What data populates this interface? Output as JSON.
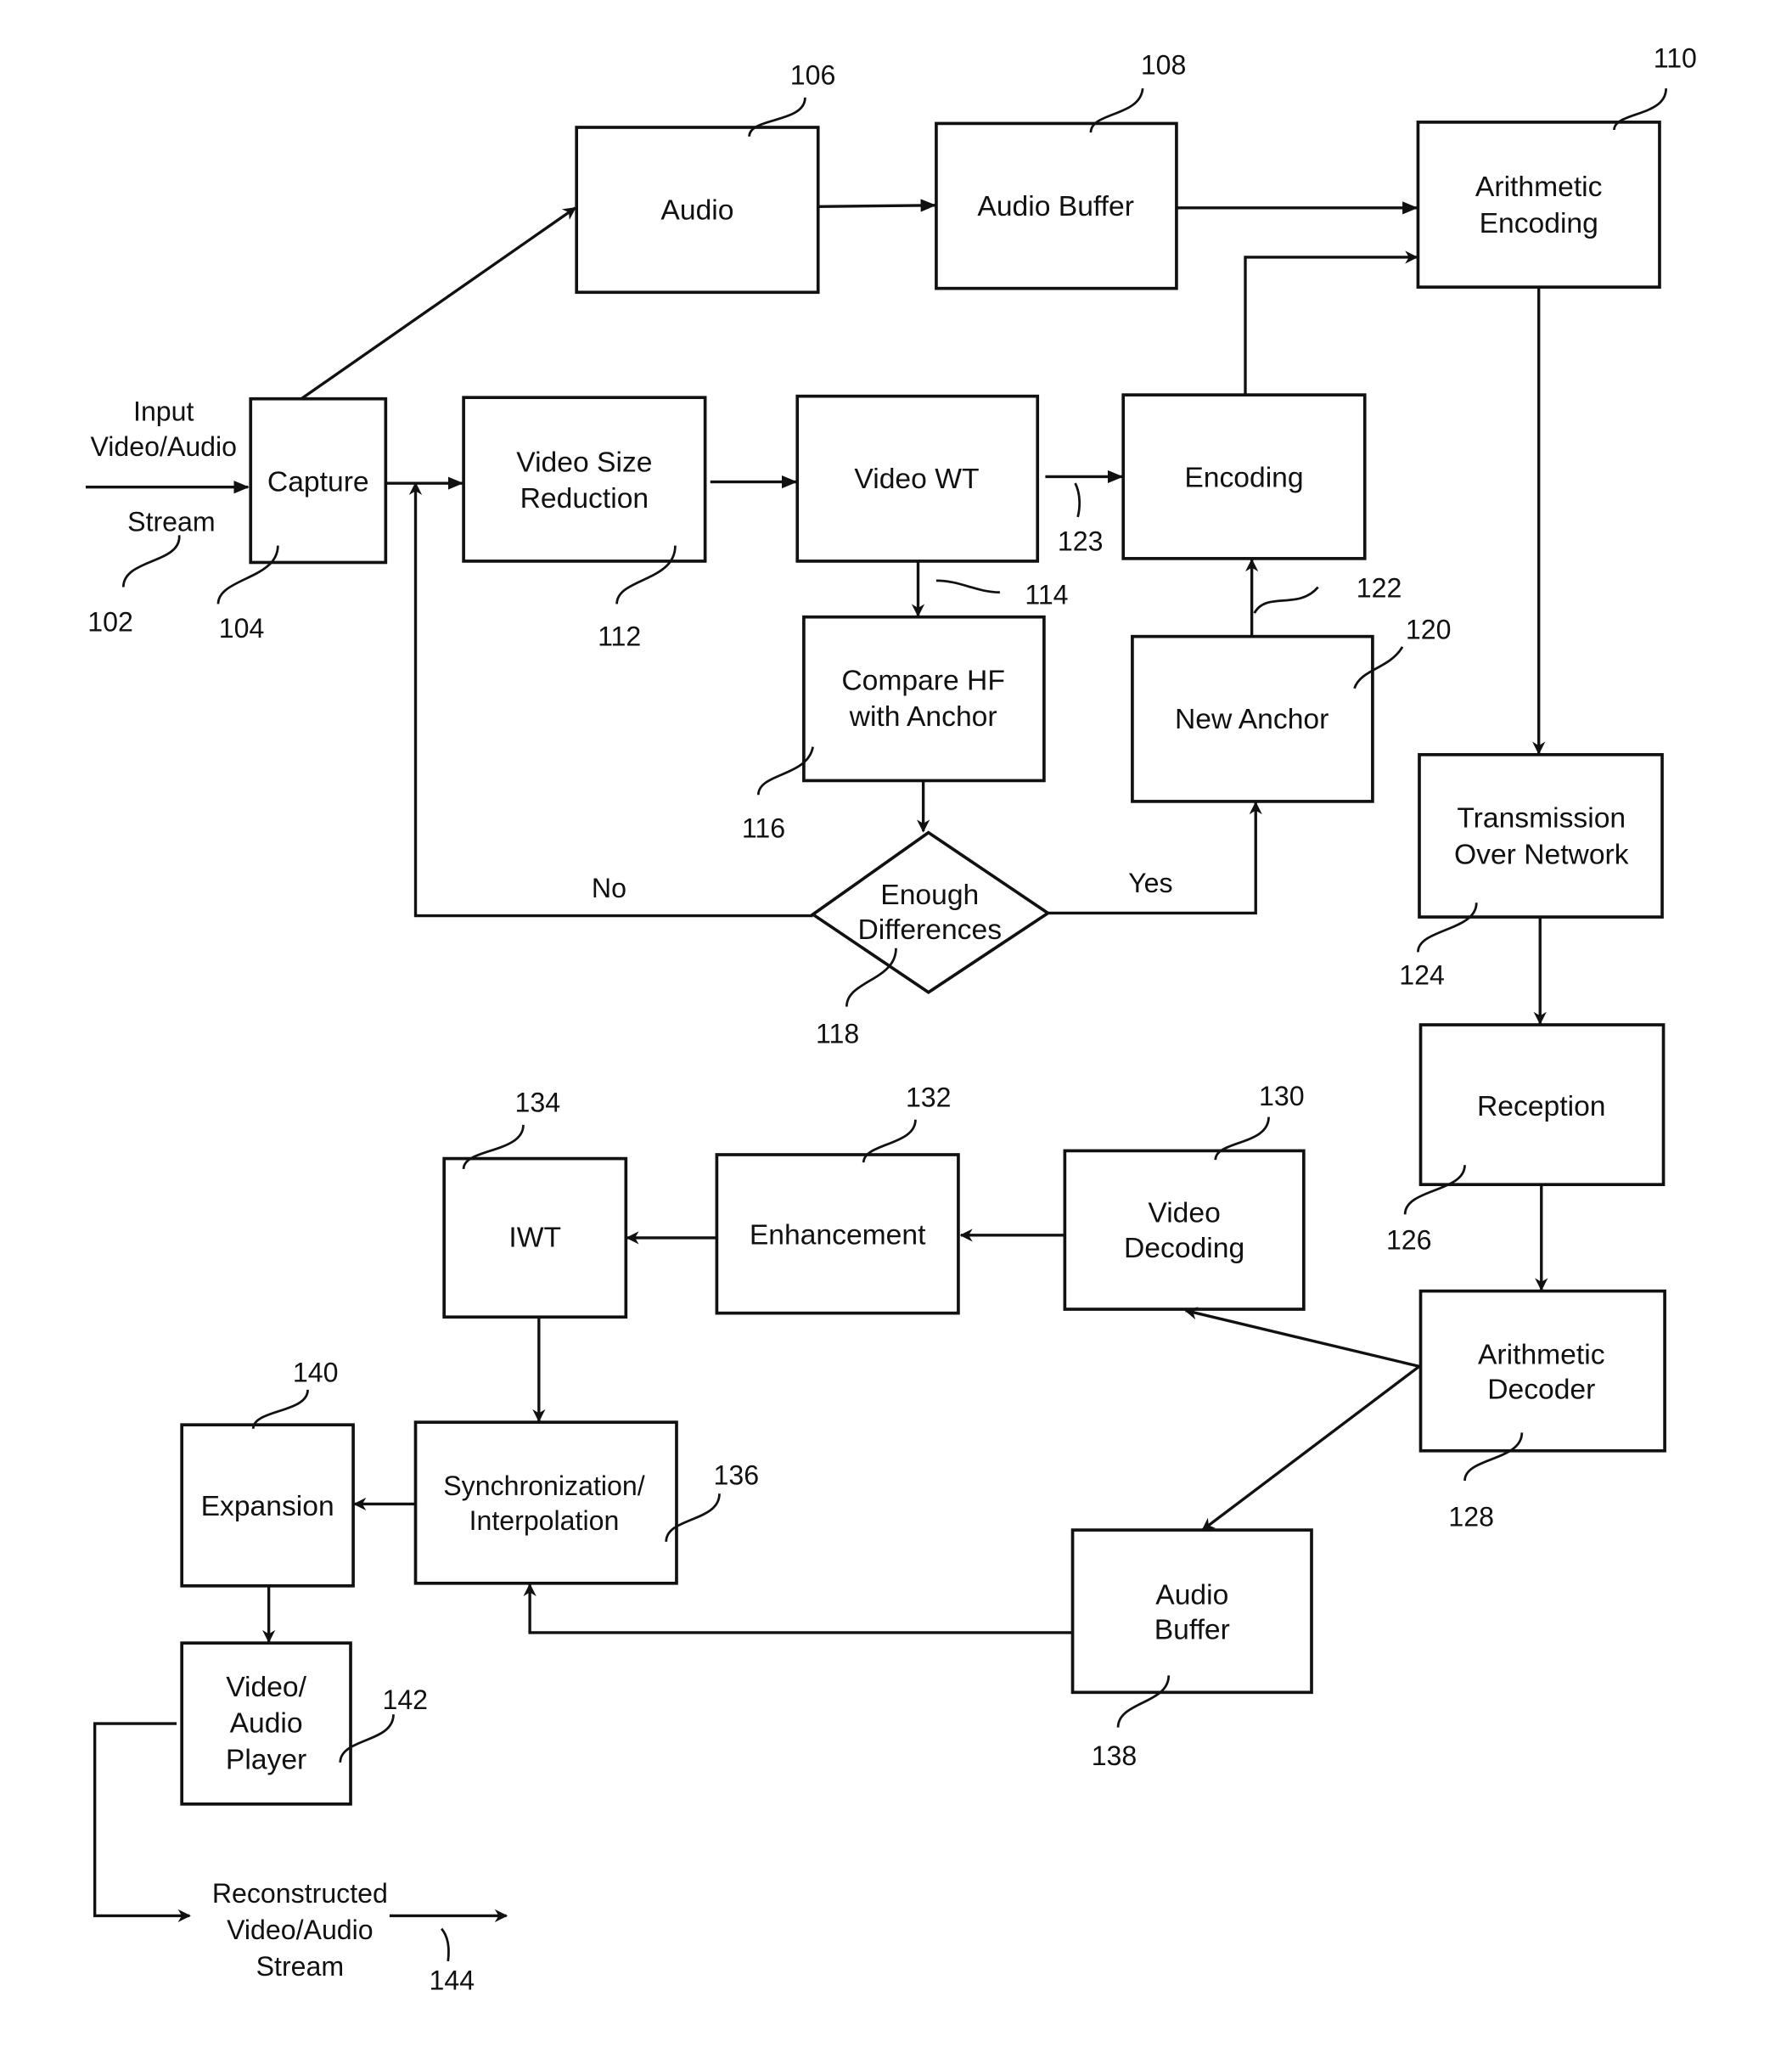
{
  "diagram": {
    "type": "flowchart",
    "input": {
      "lines": [
        "Input",
        "Video/Audio",
        "Stream"
      ],
      "ref": "102"
    },
    "output": {
      "lines": [
        "Reconstructed",
        "Video/Audio",
        "Stream"
      ],
      "ref": "144"
    },
    "blocks": {
      "capture": {
        "lines": [
          "Capture"
        ],
        "ref": "104"
      },
      "audio": {
        "lines": [
          "Audio"
        ],
        "ref": "106"
      },
      "audio_buffer_tx": {
        "lines": [
          "Audio Buffer"
        ],
        "ref": "108"
      },
      "arith_encoding": {
        "lines": [
          "Arithmetic",
          "Encoding"
        ],
        "ref": "110"
      },
      "video_size_reduction": {
        "lines": [
          "Video Size",
          "Reduction"
        ],
        "ref": "112"
      },
      "video_wt": {
        "lines": [
          "Video WT"
        ],
        "ref": "114"
      },
      "compare_hf": {
        "lines": [
          "Compare HF",
          "with Anchor"
        ],
        "ref": "116"
      },
      "enough_diff": {
        "lines": [
          "Enough",
          "Differences"
        ],
        "ref": "118"
      },
      "new_anchor": {
        "lines": [
          "New Anchor"
        ],
        "ref": "120"
      },
      "encoding": {
        "lines": [
          "Encoding"
        ],
        "ref": "123"
      },
      "transmission": {
        "lines": [
          "Transmission",
          "Over Network"
        ],
        "ref": "124"
      },
      "reception": {
        "lines": [
          "Reception"
        ],
        "ref": "126"
      },
      "arith_decoder": {
        "lines": [
          "Arithmetic",
          "Decoder"
        ],
        "ref": "128"
      },
      "video_decoding": {
        "lines": [
          "Video",
          "Decoding"
        ],
        "ref": "130"
      },
      "enhancement": {
        "lines": [
          "Enhancement"
        ],
        "ref": "132"
      },
      "iwt": {
        "lines": [
          "IWT"
        ],
        "ref": "134"
      },
      "sync_interp": {
        "lines": [
          "Synchronization/",
          "Interpolation"
        ],
        "ref": "136"
      },
      "audio_buffer_rx": {
        "lines": [
          "Audio",
          "Buffer"
        ],
        "ref": "138"
      },
      "expansion": {
        "lines": [
          "Expansion"
        ],
        "ref": "140"
      },
      "player": {
        "lines": [
          "Video/",
          "Audio",
          "Player"
        ],
        "ref": "142"
      }
    },
    "edge_refs": {
      "new_anchor_to_encoding": "122"
    },
    "branch_labels": {
      "no": "No",
      "yes": "Yes"
    }
  }
}
